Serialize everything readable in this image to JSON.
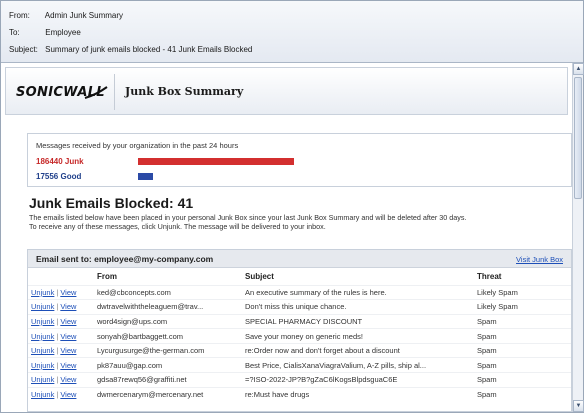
{
  "header": {
    "from_label": "From:",
    "from_value": "Admin Junk Summary",
    "to_label": "To:",
    "to_value": "Employee",
    "subject_label": "Subject:",
    "subject_value": "Summary of junk emails blocked - 41 Junk Emails Blocked"
  },
  "brand": {
    "logo_text": "SONICWALL",
    "title": "Junk Box Summary"
  },
  "stats": {
    "caption": "Messages received by your organization in the past 24 hours",
    "junk_label": "186440 Junk",
    "junk_count": 186440,
    "good_label": "17556 Good",
    "good_count": 17556,
    "junk_color": "#d32f2f",
    "good_color": "#2b4aa6"
  },
  "blocked": {
    "title": "Junk Emails Blocked: 41",
    "desc_line1": "The emails listed below have been placed in your personal Junk Box since your last Junk Box Summary and will be deleted after 30 days.",
    "desc_line2": "To receive any of these messages, click Unjunk. The message will be delivered to your inbox."
  },
  "list": {
    "sent_to": "Email sent to: employee@my-company.com",
    "visit_link": "Visit Junk Box",
    "columns": {
      "from": "From",
      "subject": "Subject",
      "threat": "Threat"
    },
    "action_unjunk": "Unjunk",
    "action_sep": "|",
    "action_view": "View",
    "rows": [
      {
        "from": "ked@cbconcepts.com",
        "subject": "An executive summary of the rules is here.",
        "threat": "Likely Spam"
      },
      {
        "from": "dwtravelwiththeleaguem@trav...",
        "subject": "Don't miss this unique chance.",
        "threat": "Likely Spam"
      },
      {
        "from": "word4sign@ups.com",
        "subject": "SPECIAL PHARMACY DISCOUNT",
        "threat": "Spam"
      },
      {
        "from": "sonyah@bartbaggett.com",
        "subject": "Save your money on generic meds!",
        "threat": "Spam"
      },
      {
        "from": "Lycurgusurge@the-german.com",
        "subject": "re:Order now and don't forget about a discount",
        "threat": "Spam"
      },
      {
        "from": "pk87auu@gap.com",
        "subject": "Best Price, CialisXanaViagraValium, A-Z pills, ship al...",
        "threat": "Spam"
      },
      {
        "from": "gdsa87rewq56@graffiti.net",
        "subject": "=?ISO-2022-JP?B?gZaC6lKogsBlpdsguaC6E",
        "threat": "Spam"
      },
      {
        "from": "dwmercenarym@mercenary.net",
        "subject": "re:Must have drugs",
        "threat": "Spam"
      }
    ]
  },
  "scrollbar": {
    "up_icon": "▲",
    "down_icon": "▼"
  }
}
